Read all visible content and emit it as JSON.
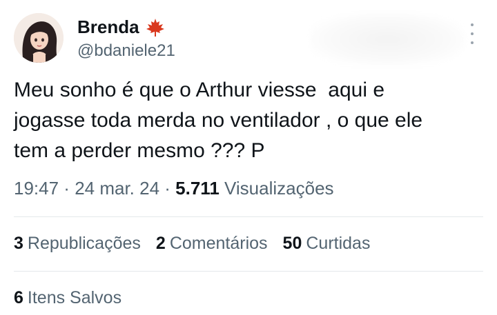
{
  "author": {
    "display_name": "Brenda",
    "badge_icon": "maple-leaf-icon",
    "handle": "@bdaniele21"
  },
  "tweet": {
    "text": "Meu sonho é que o Arthur viesse  aqui e\njogasse toda merda no ventilador , o que ele\ntem a perder mesmo ??? P"
  },
  "meta": {
    "time": "19:47",
    "sep1": " · ",
    "date": "24 mar. 24",
    "sep2": " · ",
    "views_count": "5.711",
    "views_label": "Visualizações"
  },
  "stats": {
    "reposts_count": "3",
    "reposts_label": "Republicações",
    "comments_count": "2",
    "comments_label": "Comentários",
    "likes_count": "50",
    "likes_label": "Curtidas",
    "saves_count": "6",
    "saves_label": "Itens Salvos"
  },
  "colors": {
    "text": "#0f1419",
    "secondary": "#536471",
    "divider": "#e4e8eb",
    "leaf": "#d9381e"
  }
}
